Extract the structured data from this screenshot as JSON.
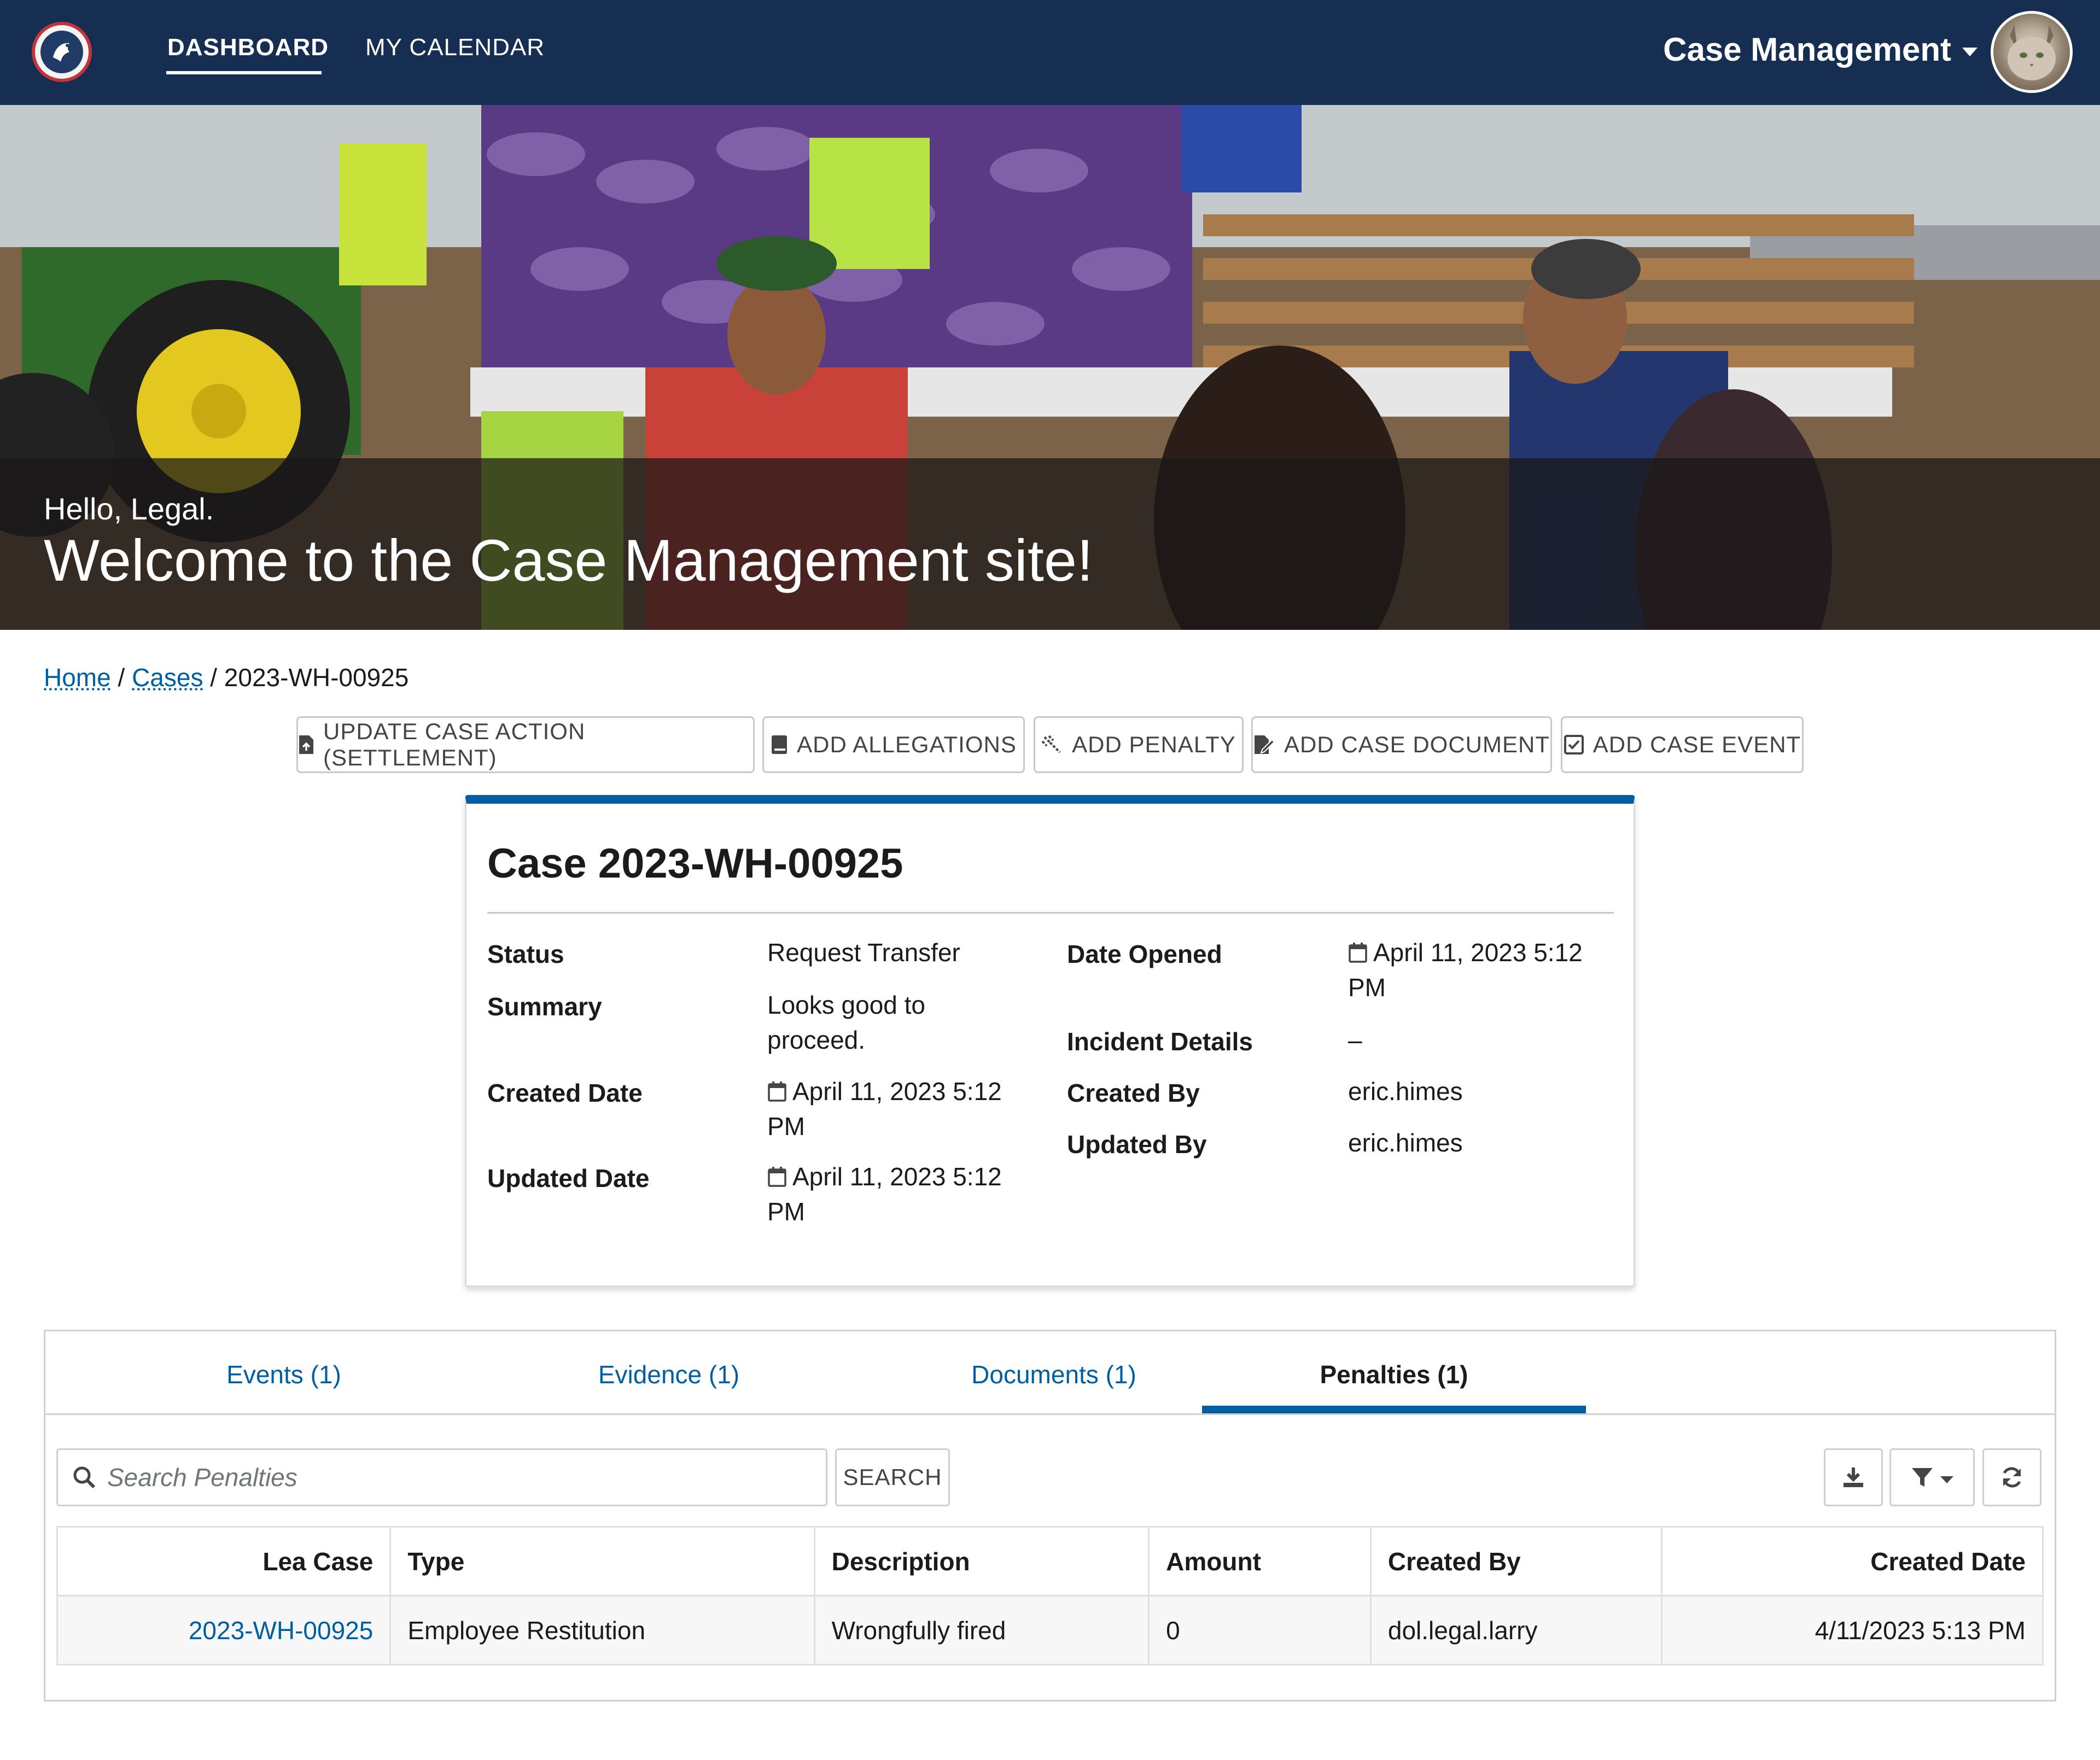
{
  "nav": {
    "links": [
      {
        "label": "DASHBOARD",
        "active": true
      },
      {
        "label": "MY CALENDAR",
        "active": false
      }
    ],
    "app_menu_label": "Case Management"
  },
  "hero": {
    "greeting": "Hello, Legal.",
    "title": "Welcome to the Case Management site!"
  },
  "breadcrumb": {
    "home": "Home",
    "cases": "Cases",
    "current": "2023-WH-00925",
    "separator": "/"
  },
  "actions": [
    {
      "label": "UPDATE CASE ACTION (SETTLEMENT)",
      "icon": "document-upload-icon"
    },
    {
      "label": "ADD ALLEGATIONS",
      "icon": "book-icon"
    },
    {
      "label": "ADD PENALTY",
      "icon": "gavel-icon"
    },
    {
      "label": "ADD CASE DOCUMENT",
      "icon": "file-edit-icon"
    },
    {
      "label": "ADD CASE EVENT",
      "icon": "calendar-check-icon"
    }
  ],
  "case": {
    "title": "Case 2023-WH-00925",
    "labels": {
      "status": "Status",
      "summary": "Summary",
      "created_date": "Created Date",
      "updated_date": "Updated Date",
      "date_opened": "Date Opened",
      "incident_details": "Incident Details",
      "created_by": "Created By",
      "updated_by": "Updated By"
    },
    "values": {
      "status": "Request Transfer",
      "summary_line1": "Looks good to",
      "summary_line2": "proceed.",
      "created_date_line1": "April 11, 2023 5:12",
      "created_date_line2": "PM",
      "updated_date_line1": "April 11, 2023 5:12",
      "updated_date_line2": "PM",
      "date_opened_line1": "April 11, 2023 5:12",
      "date_opened_line2": "PM",
      "incident_details": "–",
      "created_by": "eric.himes",
      "updated_by": "eric.himes"
    }
  },
  "tabs": [
    {
      "label": "Events (1)",
      "active": false
    },
    {
      "label": "Evidence (1)",
      "active": false
    },
    {
      "label": "Documents (1)",
      "active": false
    },
    {
      "label": "Penalties (1)",
      "active": true
    }
  ],
  "penalties": {
    "search_placeholder": "Search Penalties",
    "search_button": "SEARCH",
    "columns": [
      "Lea Case",
      "Type",
      "Description",
      "Amount",
      "Created By",
      "Created Date"
    ],
    "rows": [
      {
        "lea_case": "2023-WH-00925",
        "type": "Employee Restitution",
        "description": "Wrongfully fired",
        "amount": "0",
        "created_by": "dol.legal.larry",
        "created_date": "4/11/2023 5:13 PM"
      }
    ]
  },
  "colors": {
    "nav_bg": "#162e51",
    "accent": "#005ea2",
    "link": "#005ea2"
  }
}
